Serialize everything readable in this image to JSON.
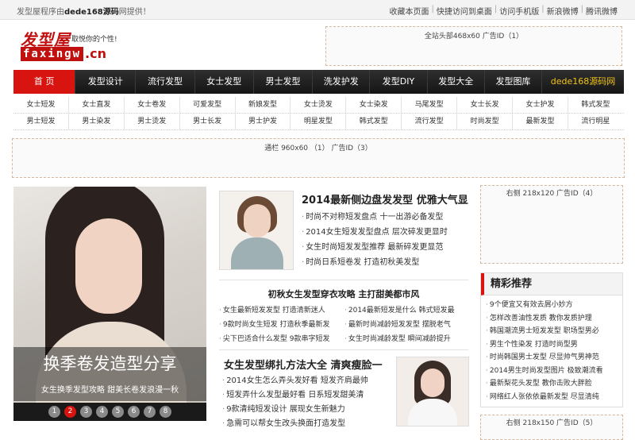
{
  "topbar": {
    "welcome_prefix": "发型屋程序由",
    "welcome_brand": "dede168源码",
    "welcome_suffix": "网提供！",
    "links": [
      "收藏本页面",
      "快捷访问到桌面",
      "访问手机版",
      "新浪微博",
      "腾讯微博"
    ]
  },
  "logo": {
    "chinese": "发型屋",
    "slogan": "取悦你的个性!",
    "english": "faxingw",
    "domain": ".cn"
  },
  "ads": {
    "top": "全站头部468x60 广告ID（1）",
    "wide": "通栏 960x60 （1） 广告ID（3）",
    "right1": "右侧 218x120 广告ID（4）",
    "right2": "右侧 218x150 广告ID（5）"
  },
  "mainnav": [
    "首 页",
    "发型设计",
    "流行发型",
    "女士发型",
    "男士发型",
    "洗发护发",
    "发型DIY",
    "发型大全",
    "发型图库",
    "dede168源码网"
  ],
  "subnav": {
    "row1": [
      "女士短发",
      "女士直发",
      "女士卷发",
      "可爱发型",
      "新娘发型",
      "女士烫发",
      "女士染发",
      "马尾发型",
      "女士长发",
      "女士护发",
      "韩式发型"
    ],
    "row2": [
      "男士短发",
      "男士染发",
      "男士烫发",
      "男士长发",
      "男士护发",
      "明星发型",
      "韩式发型",
      "流行发型",
      "时尚发型",
      "最新发型",
      "流行明星"
    ]
  },
  "slider": {
    "title": "换季卷发造型分享",
    "subtitle": "女生换季发型攻略 甜美长卷发浪漫一秋",
    "dots": [
      "1",
      "2",
      "3",
      "4",
      "5",
      "6",
      "7",
      "8"
    ],
    "active_index": 2
  },
  "article1": {
    "title": "2014最新侧边盘发发型 优雅大气显",
    "items": [
      "时尚不对称短发盘点 十一出游必备发型",
      "2014女生短发发型盘点 层次碎发更显时",
      "女生时尚短发发型推荐 最新碎发更显范",
      "时尚日系短卷发 打造初秋美发型"
    ]
  },
  "section": {
    "title": "初秋女生发型穿衣攻略 主打甜美都市风",
    "rows": [
      [
        "女生最新短发发型 打造清新迷人",
        "2014最新短发是什么 韩式短发最"
      ],
      [
        "9款时尚女生短发 打造秋季最新发",
        "最新时尚减龄短发发型 摆脱老气"
      ],
      [
        "尖下巴适合什么发型 9款串字短发",
        "女生时尚减龄发型 瞬间减龄提升"
      ]
    ]
  },
  "article2": {
    "title": "女生发型绑扎方法大全 清爽瘦脸一",
    "items": [
      "2014女生怎么弄头发好看 短发齐肩最帅",
      "短发弄什么发型最好看 日系短发甜美清",
      "9款清纯短发设计 展现女生新魅力",
      "急需可以帮女生改头换面打造发型"
    ]
  },
  "recommend": {
    "title": "精彩推荐",
    "items": [
      "9个便宜又有效去屑小妙方",
      "怎样改善油性发质 教你发质护理",
      "韩国潮流男士短发发型 职场型男必",
      "男生个性染发 打造时尚型男",
      "时尚韩国男士发型 尽显帅气男神范",
      "2014男生时尚发型图片 极致潮流看",
      "最新梨花头发型 教你击败大胖脸",
      "网络红人张依依最新发型 尽显清纯"
    ]
  },
  "colors": {
    "accent": "#d7140f",
    "nav_bg": "#1f1f1f",
    "brand_nav": "#f0c419",
    "ad_border": "#d7b79b"
  }
}
